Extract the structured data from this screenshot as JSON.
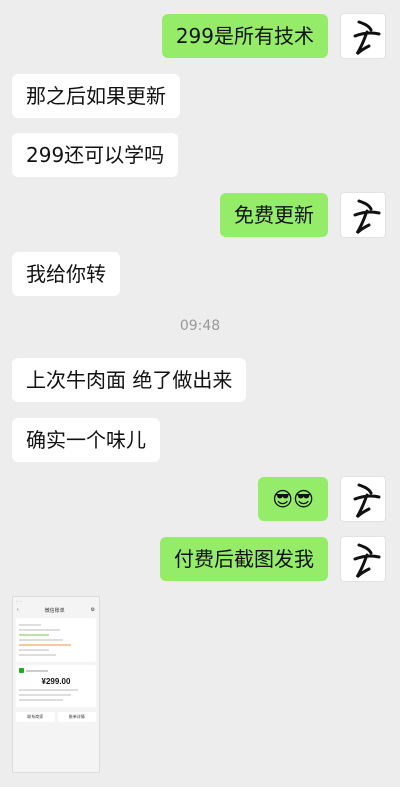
{
  "messages": [
    {
      "text": "299是所有技术"
    },
    {
      "text": "那之后如果更新"
    },
    {
      "text": "299还可以学吗"
    },
    {
      "text": "免费更新"
    },
    {
      "text": "我给你转"
    },
    {
      "text": "上次牛肉面 绝了做出来"
    },
    {
      "text": "确实一个味儿"
    },
    {
      "text": "😎😎"
    },
    {
      "text": "付费后截图发我"
    }
  ],
  "timestamp": "09:48",
  "thumbnail": {
    "title": "微信账单",
    "amount": "¥299.00",
    "left_button": "联系商家",
    "right_button": "账单详情"
  },
  "colors": {
    "background": "#ededed",
    "outgoing_bubble": "#95ec69",
    "incoming_bubble": "#ffffff",
    "timestamp_text": "#999999"
  }
}
